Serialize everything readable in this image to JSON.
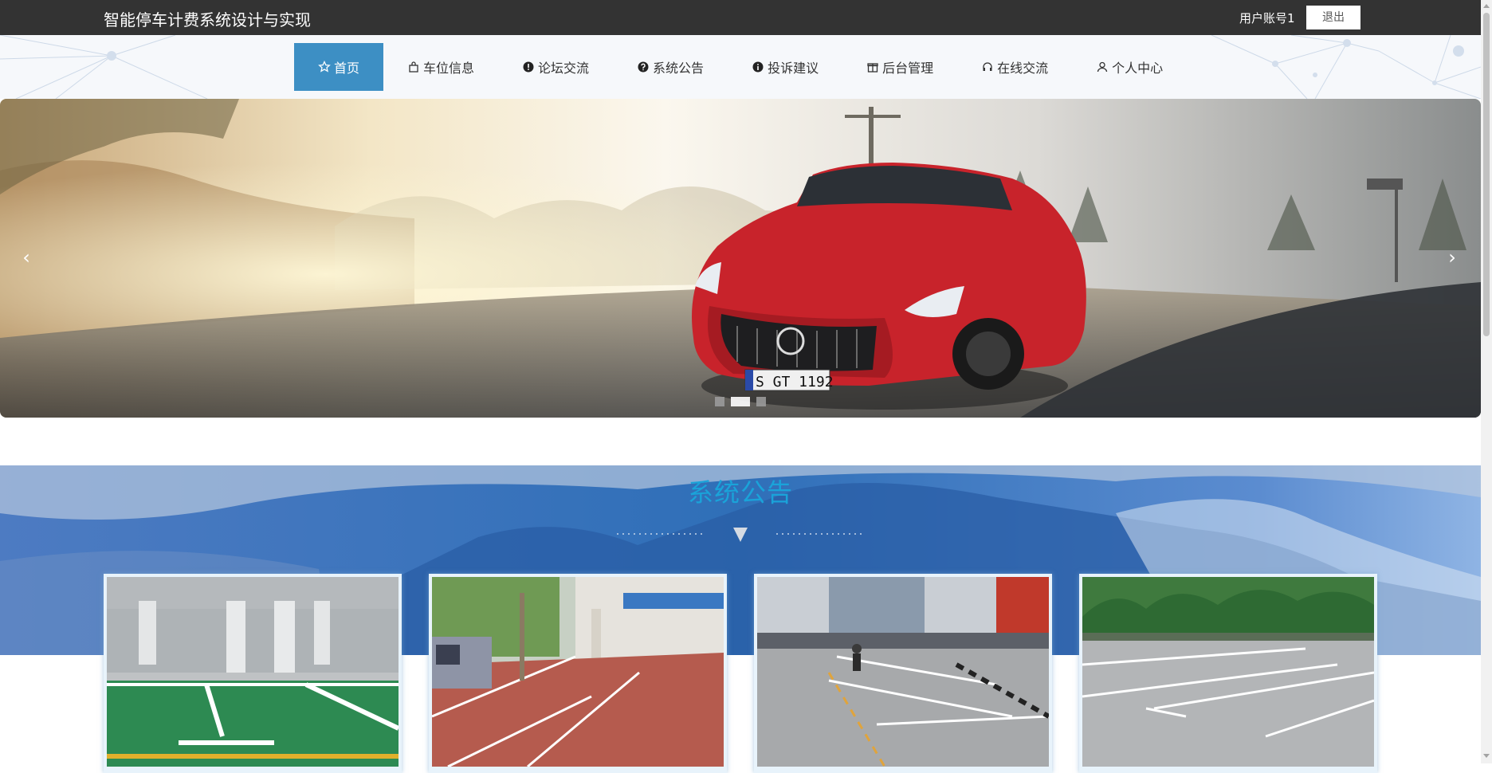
{
  "header": {
    "title": "智能停车计费系统设计与实现",
    "user_label": "用户账号1",
    "logout_label": "退出"
  },
  "nav": {
    "items": [
      {
        "label": "首页",
        "icon": "star-icon",
        "active": true
      },
      {
        "label": "车位信息",
        "icon": "bag-icon"
      },
      {
        "label": "论坛交流",
        "icon": "exclamation-circle-icon"
      },
      {
        "label": "系统公告",
        "icon": "question-circle-icon"
      },
      {
        "label": "投诉建议",
        "icon": "info-circle-icon"
      },
      {
        "label": "后台管理",
        "icon": "gift-icon"
      },
      {
        "label": "在线交流",
        "icon": "headset-icon"
      },
      {
        "label": "个人中心",
        "icon": "user-icon"
      }
    ]
  },
  "carousel": {
    "prev_symbol": "‹",
    "next_symbol": "›",
    "slide_count": 3,
    "active_slide": 2,
    "plate_text": "S GT 1192"
  },
  "announcements": {
    "title": "系统公告"
  },
  "colors": {
    "topbar": "#333333",
    "nav_active": "#3d8fc4",
    "section_title": "#1aa3d9"
  }
}
